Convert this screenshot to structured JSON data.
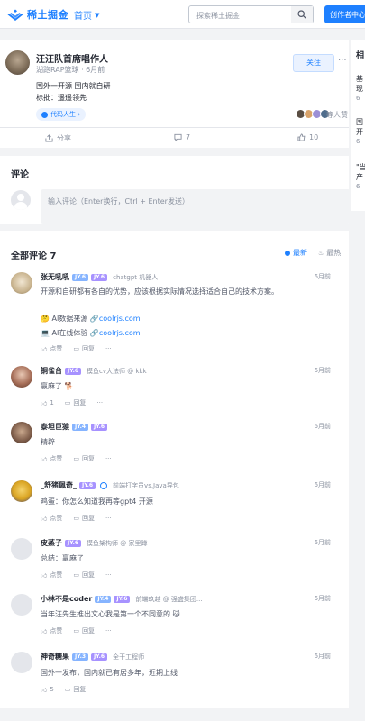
{
  "header": {
    "logo_text": "稀土掘金",
    "nav_home": "首页",
    "search_placeholder": "探索稀土掘金",
    "creator_button": "创作者中心"
  },
  "sidebar": {
    "title": "相",
    "items": [
      {
        "line1": "基",
        "line2": "现",
        "meta": "6"
      },
      {
        "line1": "国",
        "line2": "开",
        "meta": "6"
      },
      {
        "line1": "\"当",
        "line2": "产",
        "meta": "6"
      }
    ]
  },
  "post": {
    "author_name": "汪汪队首席唱作人",
    "author_meta": "湖跑RAP篮球 · 6月前",
    "follow_label": "关注",
    "line1": "国外一开源 国内就自研",
    "line2": "标批：遥遥领先",
    "circle_tag": "代码人生 ›",
    "likes_text": "等人赞",
    "share_label": "分享",
    "comment_count": "7",
    "like_count": "10"
  },
  "comment_box": {
    "title": "评论",
    "placeholder": "输入评论（Enter换行，Ctrl + Enter发送）"
  },
  "comments_section": {
    "title": "全部评论 7",
    "sort_latest": "最新",
    "sort_hot": "最热"
  },
  "comments": [
    {
      "name": "张无吼吼",
      "lv1": "JY.6",
      "lv2": "JY.6",
      "job": "chatgpt 机器人",
      "time": "6月前",
      "text": "开源和自研都有各自的优势，应该根据实际情况选择适合自己的技术方案。",
      "extra1_label": "AI数据来源",
      "extra1_link": "coolrjs.com",
      "extra2_label": "AI在线体验",
      "extra2_link": "coolrjs.com",
      "like": "点赞",
      "reply": "回复"
    },
    {
      "name": "铜雀台",
      "lv1": "JY.6",
      "job": "摸鱼cv大法师 @ kkk",
      "time": "6月前",
      "text": "赢麻了",
      "like": "1",
      "reply": "回复"
    },
    {
      "name": "泰坦巨猿",
      "lv1": "JY.4",
      "lv2": "JY.6",
      "job": "",
      "time": "6月前",
      "text": "精辟",
      "like": "点赞",
      "reply": "回复"
    },
    {
      "name": "_舒猪佩奇_",
      "lv1": "JY.6",
      "job": "前端打字员vs.Java导包",
      "time": "6月前",
      "text": "鸡蛋：你怎么知道我再等gpt4 开源",
      "like": "点赞",
      "reply": "回复"
    },
    {
      "name": "皮蒸子",
      "lv1": "JY.6",
      "job": "摸鱼架构师 @ 家里蹲",
      "time": "6月前",
      "text": "总结：赢麻了",
      "like": "点赞",
      "reply": "回复"
    },
    {
      "name": "小林不是coder",
      "lv1": "JY.4",
      "lv2": "JY.6",
      "job": "前端玖越 @ 强盛集团...",
      "time": "6月前",
      "text": "当年汪先生推出文心我是第一个不同意的",
      "like": "点赞",
      "reply": "回复"
    },
    {
      "name": "神奇糖果",
      "lv1": "JY.3",
      "lv2": "JY.6",
      "job": "全干工程师",
      "time": "6月前",
      "text": "国外一发布，国内就已有居多年，近期上线",
      "like": "5",
      "reply": "回复"
    }
  ]
}
